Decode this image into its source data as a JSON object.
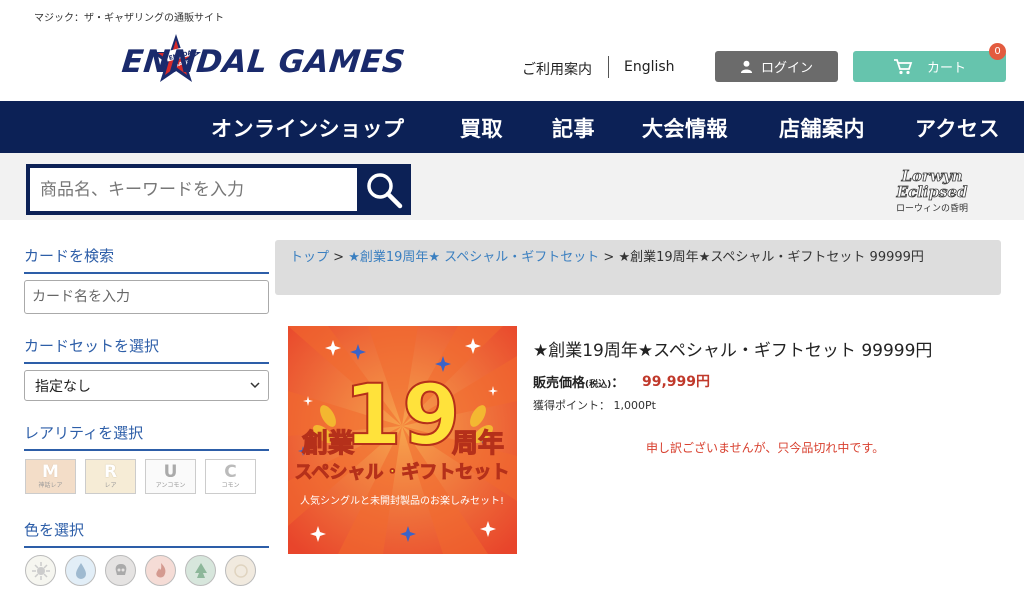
{
  "header": {
    "tagline": "マジック：ザ・ギャザリングの通販サイト",
    "logo_text": "ENNDAL GAMES",
    "logo_badge_text": "ENNDAL GAMES",
    "guide_label": "ご利用案内",
    "english_label": "English",
    "login_label": "ログイン",
    "cart_label": "カート",
    "cart_count": "0"
  },
  "nav": {
    "items": [
      "オンラインショップ",
      "買取",
      "記事",
      "大会情報",
      "店舗案内",
      "アクセス"
    ]
  },
  "search": {
    "placeholder": "商品名、キーワードを入力",
    "banner_text": "Lorwyn Eclipsed",
    "banner_sub": "ローウィンの昏明"
  },
  "sidebar": {
    "card_search_heading": "カードを検索",
    "card_input_placeholder": "カード名を入力",
    "set_heading": "カードセットを選択",
    "set_selected": "指定なし",
    "rarity_heading": "レアリティを選択",
    "rarities": [
      {
        "letter": "M",
        "sub": "神話レア"
      },
      {
        "letter": "R",
        "sub": "レア"
      },
      {
        "letter": "U",
        "sub": "アンコモン"
      },
      {
        "letter": "C",
        "sub": "コモン"
      }
    ],
    "color_heading": "色を選択",
    "colors": [
      "white-mana-icon",
      "blue-mana-icon",
      "black-mana-icon",
      "red-mana-icon",
      "green-mana-icon",
      "colorless-mana-icon"
    ]
  },
  "breadcrumb": {
    "top": "トップ",
    "sep": ">",
    "category": "★創業19周年★ スペシャル・ギフトセット",
    "current": "★創業19周年★スペシャル・ギフトセット 99999円"
  },
  "product": {
    "title": "★創業19周年★スペシャル・ギフトセット 99999円",
    "price_label": "販売価格",
    "price_tax_note": "(税込)",
    "price_colon": "：",
    "price_value": "99,999円",
    "points_label": "獲得ポイント：",
    "points_value": "1,000Pt",
    "soldout_message": "申し訳ございませんが、只今品切れ中です。",
    "image": {
      "line1": "創業",
      "number": "19",
      "line1b": "周年",
      "line2": "スペシャル・ギフトセット",
      "line3": "人気シングルと未開封製品のお楽しみセット!"
    }
  }
}
